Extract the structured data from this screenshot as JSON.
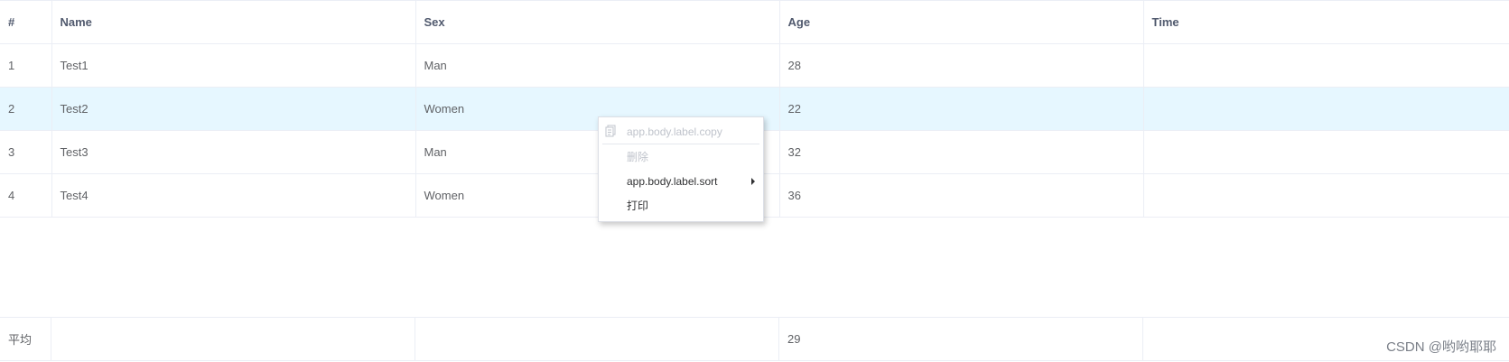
{
  "table": {
    "columns": [
      "#",
      "Name",
      "Sex",
      "Age",
      "Time"
    ],
    "rows": [
      [
        "1",
        "Test1",
        "Man",
        "28",
        ""
      ],
      [
        "2",
        "Test2",
        "Women",
        "22",
        ""
      ],
      [
        "3",
        "Test3",
        "Man",
        "32",
        ""
      ],
      [
        "4",
        "Test4",
        "Women",
        "36",
        ""
      ]
    ],
    "selected_row": 2,
    "footer": [
      "平均",
      "",
      "",
      "29",
      ""
    ]
  },
  "context_menu": {
    "items": [
      {
        "label": "app.body.label.copy",
        "disabled": true,
        "icon": "copy-icon"
      },
      {
        "label": "删除",
        "disabled": true
      },
      {
        "label": "app.body.label.sort",
        "disabled": false,
        "submenu": true
      },
      {
        "label": "打印",
        "disabled": false
      }
    ]
  },
  "watermark": "CSDN @哟哟耶耶",
  "colors": {
    "border": "#ebeef5",
    "selected_row": "#e6f7ff",
    "text": "#606266",
    "header_text": "#515a6e",
    "disabled_text": "#c0c4cc"
  }
}
